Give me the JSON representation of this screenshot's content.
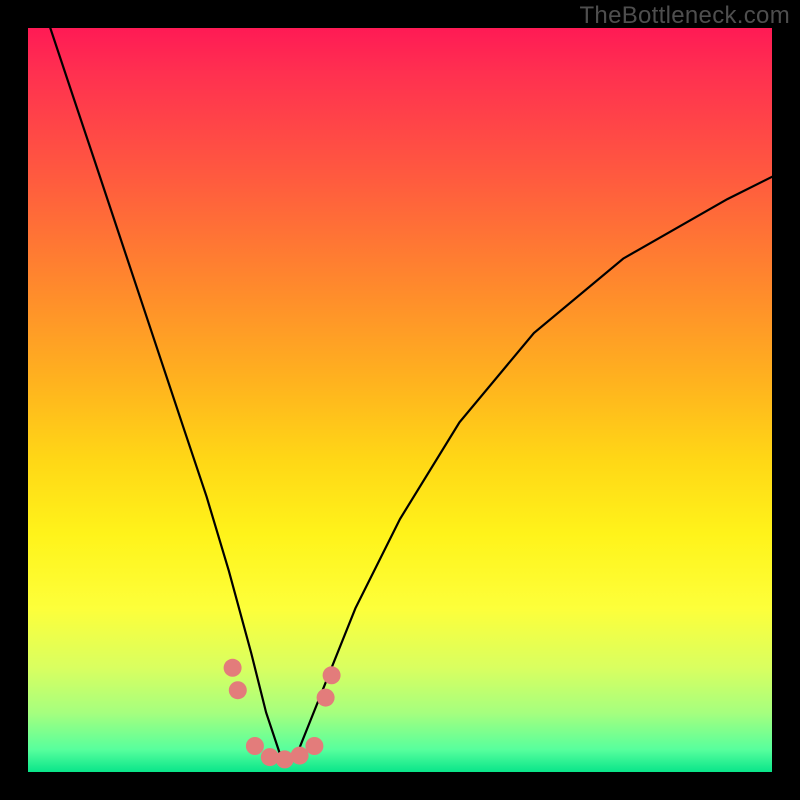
{
  "watermark": "TheBottleneck.com",
  "colors": {
    "frame": "#000000",
    "curve": "#000000",
    "marker_fill": "#e37c7b",
    "gradient_top": "#ff1a55",
    "gradient_bottom": "#09e58a"
  },
  "chart_data": {
    "type": "line",
    "title": "",
    "xlabel": "",
    "ylabel": "",
    "xlim": [
      0,
      100
    ],
    "ylim": [
      0,
      100
    ],
    "note": "Axes are unlabeled in the source image; x and y are normalized 0–100. The curve is a V-shaped valley (bottleneck-style) with its minimum near x≈34. y values estimated from vertical position relative to the gradient.",
    "series": [
      {
        "name": "curve",
        "x": [
          3,
          6,
          9,
          12,
          15,
          18,
          21,
          24,
          27,
          30,
          32,
          34,
          36,
          38,
          40,
          44,
          50,
          58,
          68,
          80,
          94,
          100
        ],
        "y": [
          100,
          91,
          82,
          73,
          64,
          55,
          46,
          37,
          27,
          16,
          8,
          2,
          2,
          7,
          12,
          22,
          34,
          47,
          59,
          69,
          77,
          80
        ]
      }
    ],
    "markers": {
      "name": "highlighted-points",
      "note": "Pink circular markers clustered around the valley floor and lower walls.",
      "points": [
        {
          "x": 27.5,
          "y": 14
        },
        {
          "x": 28.2,
          "y": 11
        },
        {
          "x": 30.5,
          "y": 3.5
        },
        {
          "x": 32.5,
          "y": 2
        },
        {
          "x": 34.5,
          "y": 1.7
        },
        {
          "x": 36.5,
          "y": 2.2
        },
        {
          "x": 38.5,
          "y": 3.5
        },
        {
          "x": 40.0,
          "y": 10
        },
        {
          "x": 40.8,
          "y": 13
        }
      ],
      "radius": 9
    }
  }
}
